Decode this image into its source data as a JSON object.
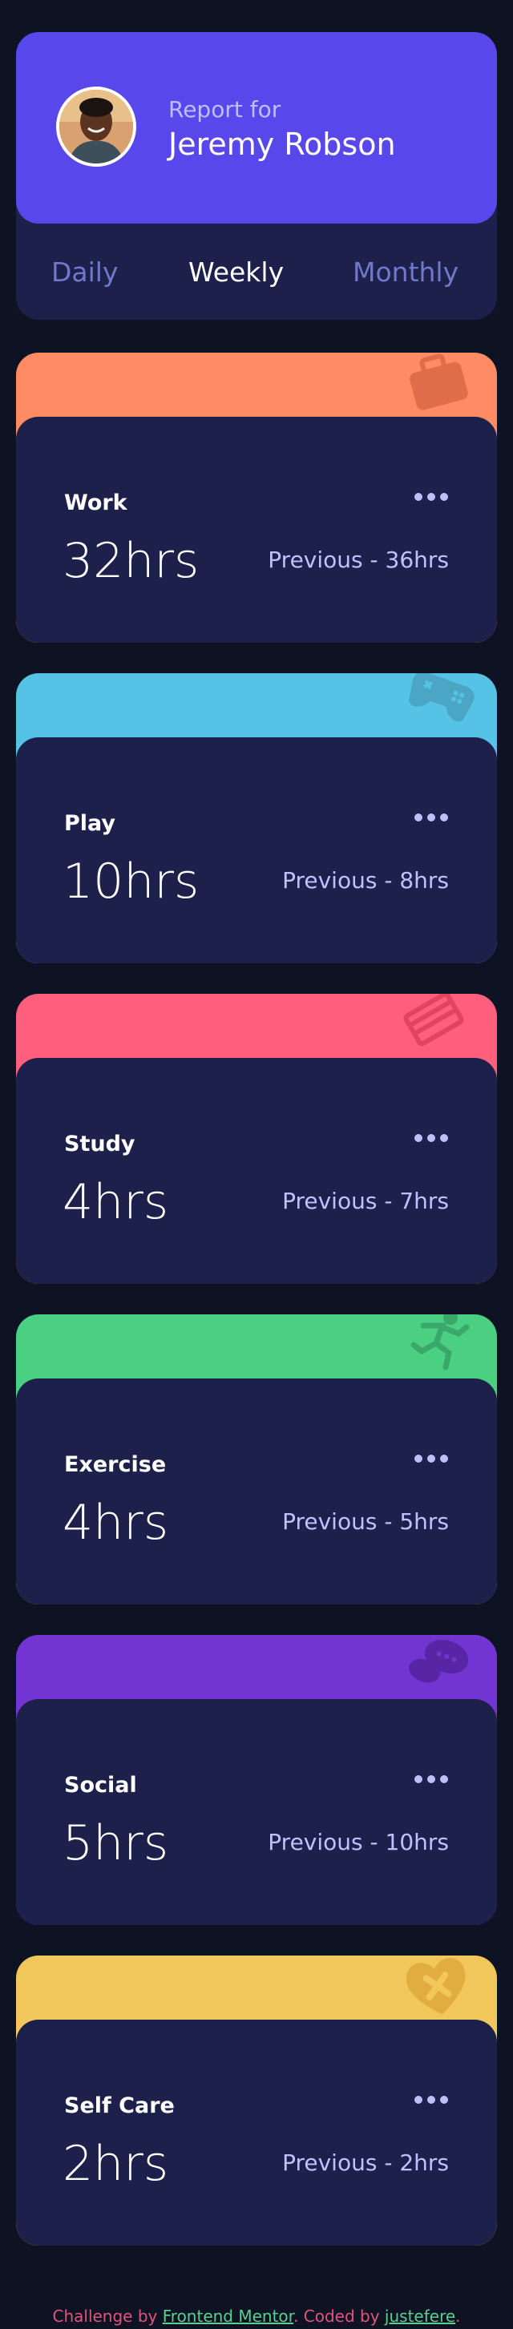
{
  "profile": {
    "report_for": "Report for",
    "name": "Jeremy Robson",
    "avatar_icon": "avatar-photo"
  },
  "tabs": [
    {
      "label": "Daily",
      "active": false
    },
    {
      "label": "Weekly",
      "active": true
    },
    {
      "label": "Monthly",
      "active": false
    }
  ],
  "activities": [
    {
      "title": "Work",
      "current": "32hrs",
      "previous": "Previous - 36hrs",
      "color": "#ff8b64",
      "icon": "briefcase-icon"
    },
    {
      "title": "Play",
      "current": "10hrs",
      "previous": "Previous - 8hrs",
      "color": "#55c2e6",
      "icon": "gamepad-icon"
    },
    {
      "title": "Study",
      "current": "4hrs",
      "previous": "Previous - 7hrs",
      "color": "#ff5e7d",
      "icon": "book-icon"
    },
    {
      "title": "Exercise",
      "current": "4hrs",
      "previous": "Previous - 5hrs",
      "color": "#4bcf82",
      "icon": "runner-icon"
    },
    {
      "title": "Social",
      "current": "5hrs",
      "previous": "Previous - 10hrs",
      "color": "#7335d2",
      "icon": "chat-bubbles-icon"
    },
    {
      "title": "Self Care",
      "current": "2hrs",
      "previous": "Previous - 2hrs",
      "color": "#f1c75b",
      "icon": "heart-cross-icon"
    }
  ],
  "attribution": {
    "prefix": "Challenge by ",
    "link1": "Frontend Mentor",
    "middle": ". Coded by ",
    "link2": "justefere",
    "suffix": "."
  },
  "colors": {
    "background": "#0e1323",
    "card": "#1c204b",
    "accent": "#5847eb",
    "muted_text": "#7078c9"
  }
}
